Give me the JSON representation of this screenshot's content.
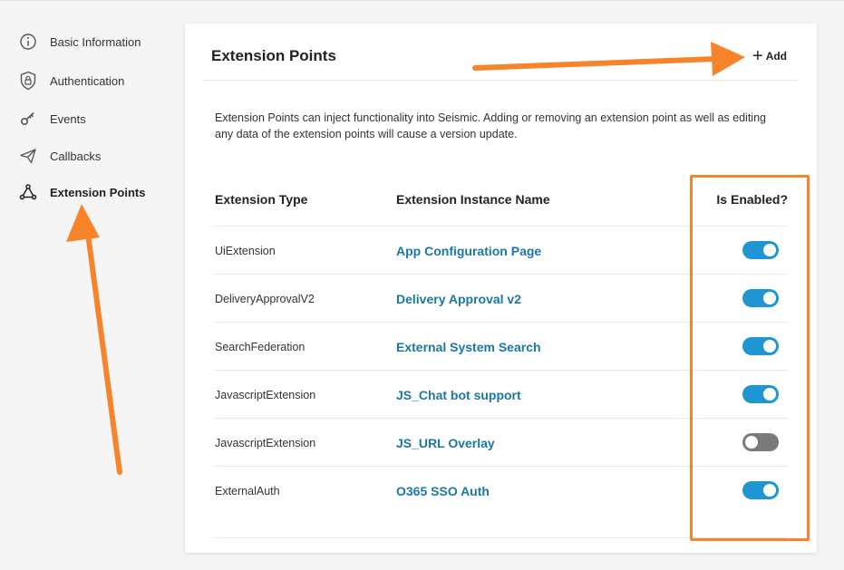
{
  "sidebar": {
    "items": [
      {
        "label": "Basic Information",
        "icon": "info-icon",
        "active": false
      },
      {
        "label": "Authentication",
        "icon": "shield-lock-icon",
        "active": false
      },
      {
        "label": "Events",
        "icon": "key-icon",
        "active": false
      },
      {
        "label": "Callbacks",
        "icon": "paper-plane-icon",
        "active": false
      },
      {
        "label": "Extension Points",
        "icon": "nodes-icon",
        "active": true
      }
    ]
  },
  "card": {
    "title": "Extension Points",
    "add_label": "Add",
    "add_icon": "plus-icon",
    "description": "Extension Points can inject functionality into Seismic. Adding or removing an extension point as well as editing any data of the extension points will cause a version update."
  },
  "table": {
    "headers": {
      "type": "Extension Type",
      "name": "Extension Instance Name",
      "enabled": "Is Enabled?"
    },
    "rows": [
      {
        "type": "UiExtension",
        "name": "App Configuration Page",
        "enabled": true
      },
      {
        "type": "DeliveryApprovalV2",
        "name": "Delivery Approval v2",
        "enabled": true
      },
      {
        "type": "SearchFederation",
        "name": "External System Search",
        "enabled": true
      },
      {
        "type": "JavascriptExtension",
        "name": "JS_Chat bot support",
        "enabled": true
      },
      {
        "type": "JavascriptExtension",
        "name": "JS_URL Overlay",
        "enabled": false
      },
      {
        "type": "ExternalAuth",
        "name": "O365 SSO Auth",
        "enabled": true
      }
    ]
  },
  "colors": {
    "accent_link": "#1b77a3",
    "toggle_on": "#1f96d1",
    "toggle_off": "#7a7a7a",
    "annotation": "#f7842b"
  }
}
